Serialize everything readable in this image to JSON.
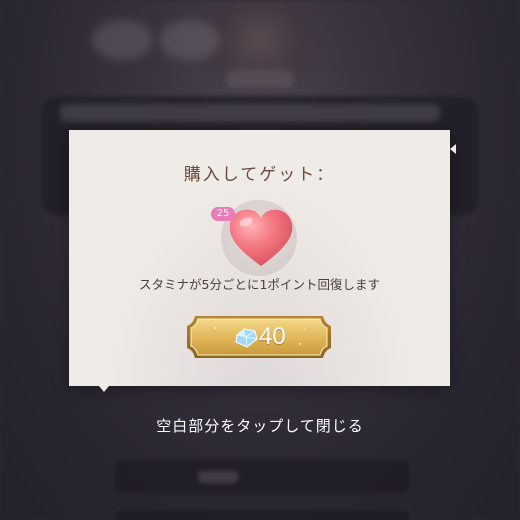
{
  "dialog": {
    "title": "購入してゲット：",
    "item": {
      "icon": "heart-icon",
      "count": "25"
    },
    "description": "スタミナが5分ごとに1ポイント回復します",
    "buy_button": {
      "icon": "gem-icon",
      "price": "40"
    }
  },
  "close_hint": "空白部分をタップして閉じる",
  "colors": {
    "dialog_bg": "#efebe7",
    "title": "#6b4a3e",
    "badge": "#e97bb6",
    "heart": "#f0707e",
    "button_gold": "#e2b85a"
  }
}
